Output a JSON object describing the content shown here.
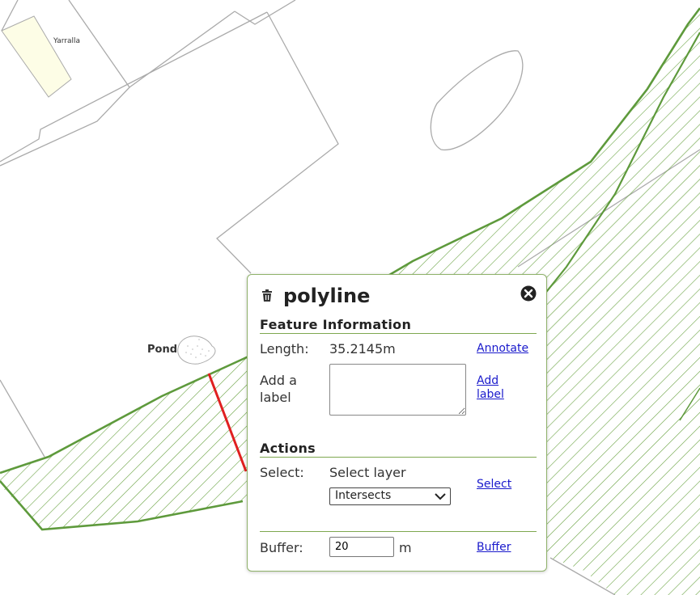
{
  "map": {
    "labels": {
      "pond": "Pond",
      "building": "Yarralla"
    },
    "colors": {
      "hatch": "#6aa343",
      "boundary": "#5e9a3c",
      "outline": "#aaaaaa",
      "measure_line": "#e02020",
      "building_fill": "#fdfde6"
    }
  },
  "popup": {
    "icons": {
      "delete": "trash-icon",
      "close": "close-icon"
    },
    "title": "polyline",
    "feature_info": {
      "heading": "Feature Information",
      "length_label": "Length:",
      "length_value": "35.2145m",
      "annotate_link": "Annotate",
      "label_prompt": "Add a label",
      "label_value": "",
      "add_label_link": "Add label"
    },
    "actions": {
      "heading": "Actions",
      "select_label": "Select:",
      "select_layer_text": "Select layer",
      "spatial_option": "Intersects",
      "select_link": "Select",
      "buffer_label": "Buffer:",
      "buffer_value": "20",
      "buffer_unit": "m",
      "buffer_link": "Buffer"
    }
  }
}
